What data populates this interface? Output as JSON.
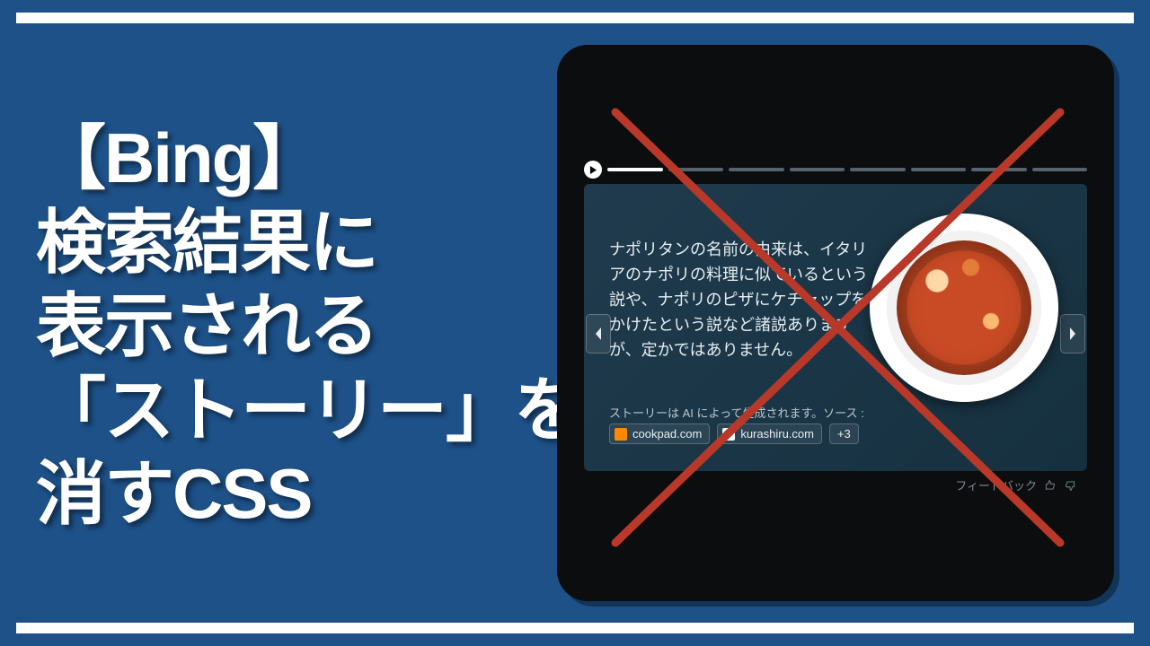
{
  "title": {
    "line1": "【Bing】",
    "line2": "検索結果に",
    "line3": "表示される",
    "line4": "「ストーリー」を",
    "line5": "消すCSS"
  },
  "story": {
    "body": "ナポリタンの名前の由来は、イタリアのナポリの料理に似ているという説や、ナポリのピザにケチャップをかけたという説など諸説ありますが、定かではありません。",
    "ai_source_label": "ストーリーは AI によって生成されます。ソース :",
    "chips": {
      "a": "cookpad.com",
      "b": "kurashiru.com",
      "more": "+3"
    },
    "feedback_label": "フィードバック"
  },
  "icons": {
    "play": "play-icon",
    "prev": "chevron-left-icon",
    "next": "chevron-right-icon",
    "like": "thumb-up-icon",
    "dislike": "thumb-down-icon",
    "cross": "cross-overlay"
  }
}
